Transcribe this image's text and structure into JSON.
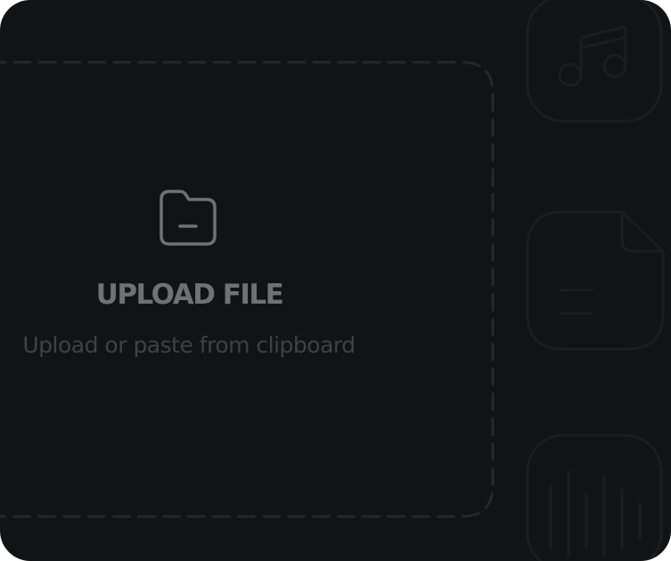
{
  "upload": {
    "icon": "folder-minus-icon",
    "title": "UPLOAD FILE",
    "subtitle": "Upload or paste from clipboard"
  },
  "side_icons": [
    {
      "name": "music-note-icon"
    },
    {
      "name": "document-icon"
    },
    {
      "name": "audio-waveform-icon"
    }
  ],
  "colors": {
    "background": "#111315",
    "title_text": "#6f7174",
    "subtitle_text": "#3f4245",
    "dashed_border": "#25292b",
    "side_icon_stroke": "#1b1e20"
  }
}
